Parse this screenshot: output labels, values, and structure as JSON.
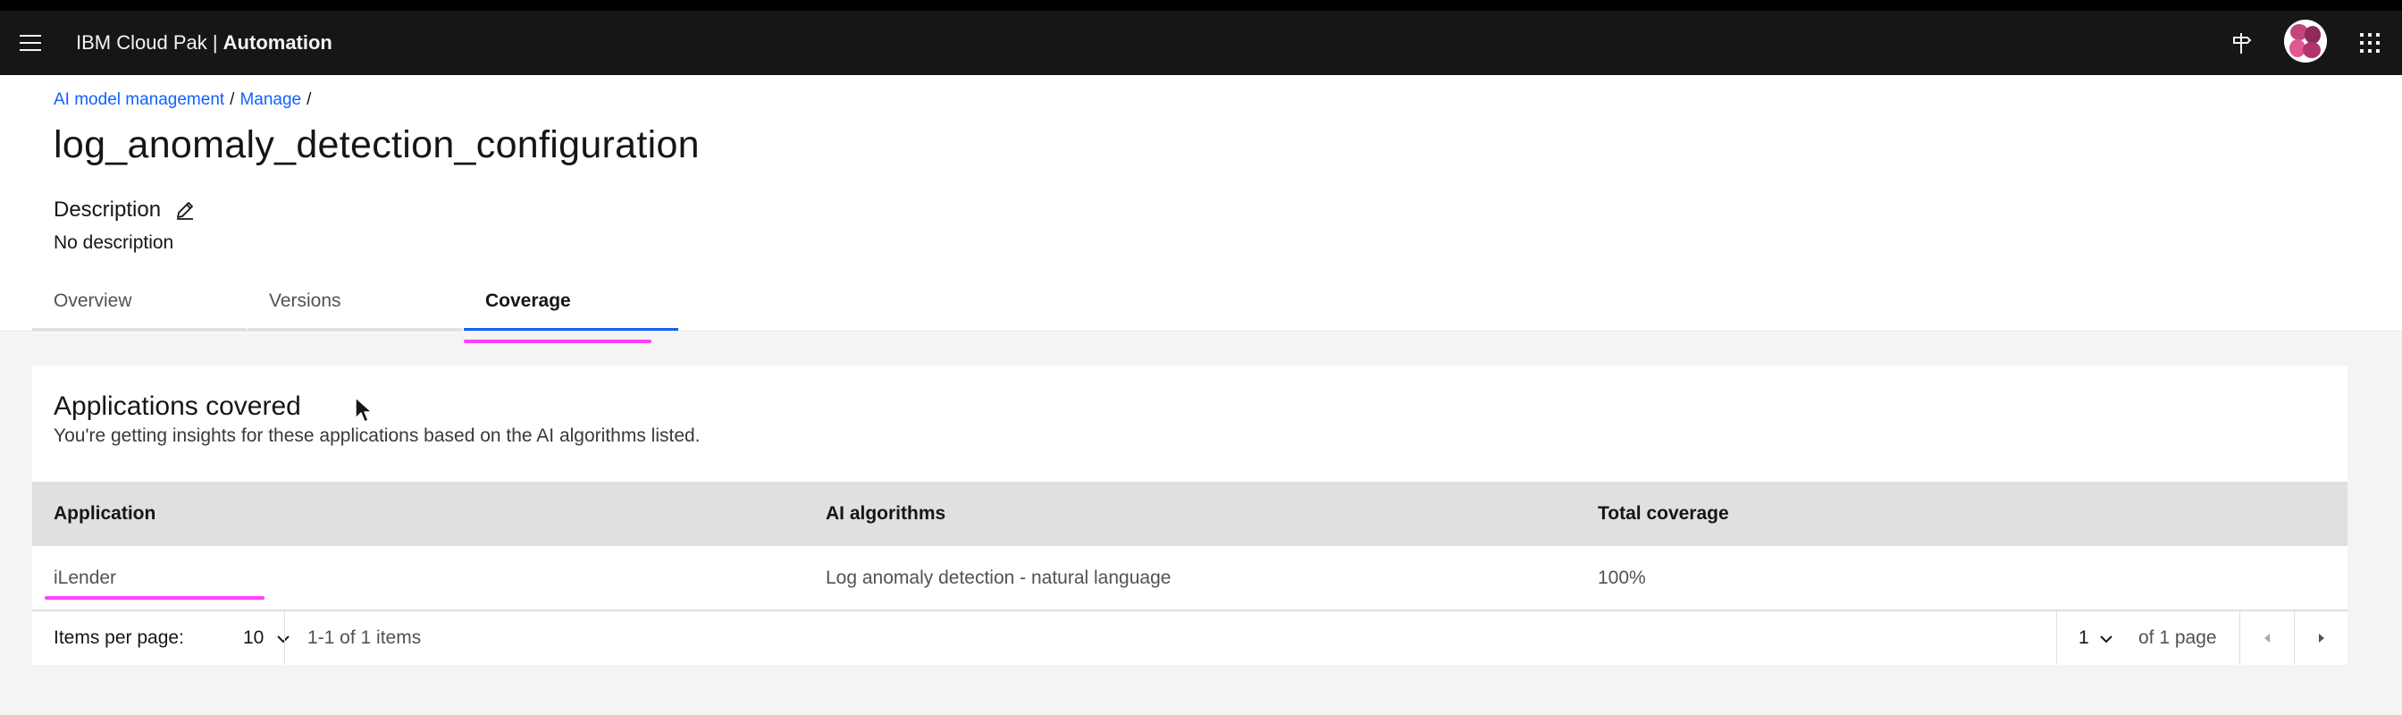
{
  "header": {
    "brand_prefix": "IBM Cloud Pak | ",
    "brand_product": "Automation"
  },
  "breadcrumb": {
    "items": [
      "AI model management",
      "Manage"
    ],
    "separator": "/"
  },
  "page": {
    "title": "log_anomaly_detection_configuration",
    "description_label": "Description",
    "description_value": "No description"
  },
  "tabs": [
    {
      "label": "Overview",
      "active": false
    },
    {
      "label": "Versions",
      "active": false
    },
    {
      "label": "Coverage",
      "active": true
    }
  ],
  "coverage": {
    "title": "Applications covered",
    "subtitle": "You're getting insights for these applications based on the AI algorithms listed.",
    "columns": [
      "Application",
      "AI algorithms",
      "Total coverage"
    ],
    "rows": [
      {
        "application": "iLender",
        "algorithms": "Log anomaly detection - natural language",
        "coverage": "100%"
      }
    ]
  },
  "pagination": {
    "items_per_page_label": "Items per page:",
    "items_per_page_value": "10",
    "range_text": "1-1 of 1 items",
    "page_value": "1",
    "page_total_text": "of 1 page"
  },
  "colors": {
    "topbar": "#161616",
    "link": "#0f62fe",
    "active_tab": "#0f62fe",
    "highlight": "#ff40ff",
    "table_header": "#e0e0e0"
  },
  "icons": [
    "menu-icon",
    "signpost-icon",
    "user-avatar",
    "app-switcher-icon",
    "edit-icon",
    "chevron-down-icon",
    "caret-left-icon",
    "caret-right-icon",
    "mouse-cursor"
  ]
}
